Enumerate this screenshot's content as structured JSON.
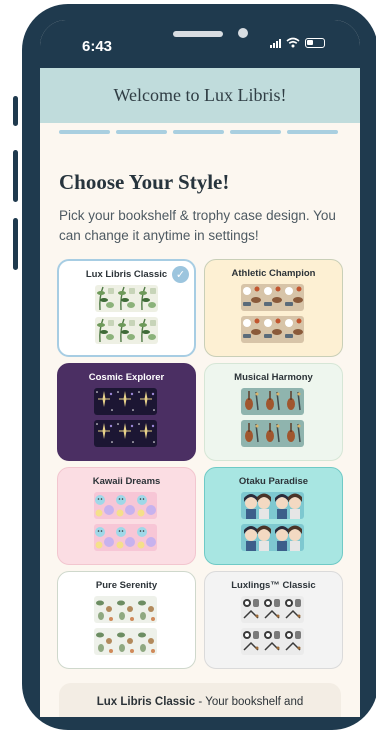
{
  "status": {
    "time": "6:43"
  },
  "header": {
    "title": "Welcome to Lux Libris!"
  },
  "page": {
    "title": "Choose Your Style!",
    "subtitle": "Pick your bookshelf & trophy case design. You can change it anytime in settings!"
  },
  "progress": {
    "steps": 5
  },
  "themes": [
    {
      "label": "Lux Libris Classic",
      "selected": true,
      "bg": "#ffffff",
      "border": "#a7cde3",
      "thumb": "botanical-pattern"
    },
    {
      "label": "Athletic Champion",
      "selected": false,
      "bg": "#fdf0d3",
      "border": "#c9cfb7",
      "thumb": "sports-pattern"
    },
    {
      "label": "Cosmic Explorer",
      "selected": false,
      "bg": "#4b2f63",
      "border": "#4b2f63",
      "thumb": "celestial-pattern"
    },
    {
      "label": "Musical Harmony",
      "selected": false,
      "bg": "#eef6ee",
      "border": "#d6e6d6",
      "thumb": "instrument-pattern"
    },
    {
      "label": "Kawaii Dreams",
      "selected": false,
      "bg": "#fbdde3",
      "border": "#f2c6cf",
      "thumb": "kawaii-pattern"
    },
    {
      "label": "Otaku Paradise",
      "selected": false,
      "bg": "#a8e6e2",
      "border": "#6fcac6",
      "thumb": "anime-pattern"
    },
    {
      "label": "Pure Serenity",
      "selected": false,
      "bg": "#ffffff",
      "border": "#cfd8cc",
      "thumb": "nature-pattern"
    },
    {
      "label": "Luxlings™ Classic",
      "selected": false,
      "bg": "#f3f3f3",
      "border": "#dadada",
      "thumb": "monochrome-pattern"
    }
  ],
  "summary": {
    "name": "Lux Libris Classic",
    "text": " - Your bookshelf and"
  },
  "colors": {
    "frame": "#1f3a4e",
    "header_bg": "#c0dcdc",
    "page_bg": "#fcf7f0",
    "accent": "#9cc5de"
  }
}
